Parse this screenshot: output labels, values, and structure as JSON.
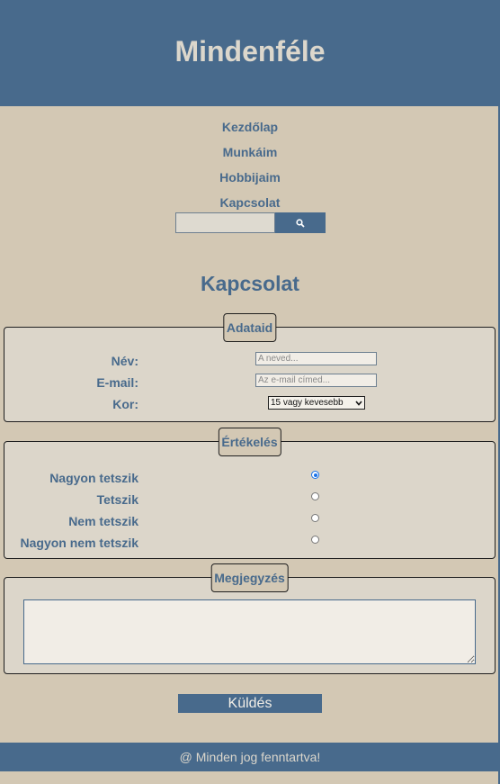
{
  "header": {
    "title": "Mindenféle"
  },
  "nav": {
    "items": [
      "Kezdőlap",
      "Munkáim",
      "Hobbijaim",
      "Kapcsolat"
    ]
  },
  "search": {
    "placeholder": "",
    "button_icon": "search-icon"
  },
  "page_title": "Kapcsolat",
  "adataid": {
    "legend": "Adataid",
    "name_label": "Név:",
    "name_placeholder": "A neved...",
    "email_label": "E-mail:",
    "email_placeholder": "Az e-mail címed...",
    "age_label": "Kor:",
    "age_selected": "15 vagy kevesebb"
  },
  "ertekeles": {
    "legend": "Értékelés",
    "options": [
      {
        "label": "Nagyon tetszik",
        "checked": true
      },
      {
        "label": "Tetszik",
        "checked": false
      },
      {
        "label": "Nem tetszik",
        "checked": false
      },
      {
        "label": "Nagyon nem tetszik",
        "checked": false
      }
    ]
  },
  "megjegyzes": {
    "legend": "Megjegyzés",
    "value": ""
  },
  "submit_label": "Küldés",
  "footer": {
    "text": "@ Minden jog fenntartva!"
  },
  "colors": {
    "primary": "#486a8c",
    "background": "#d3c8b4",
    "fieldset_bg": "#dcd6ca",
    "radio_accent": "#1a73e8"
  }
}
